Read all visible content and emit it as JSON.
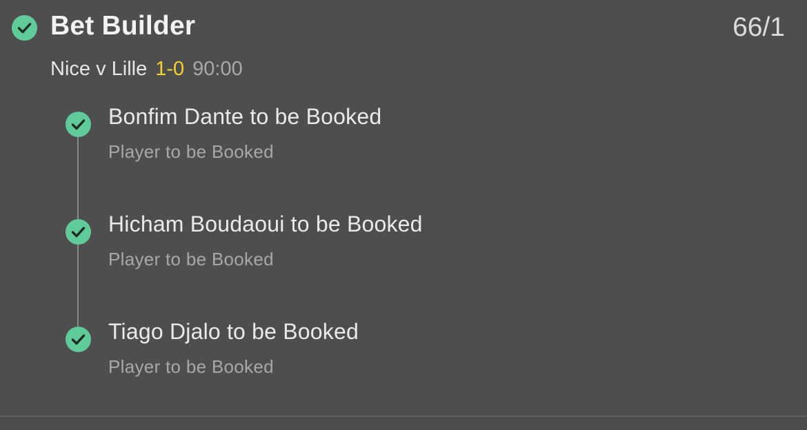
{
  "bet": {
    "title": "Bet Builder",
    "odds": "66/1",
    "status_icon": "check-circle-icon"
  },
  "match": {
    "name": "Nice v Lille",
    "score": "1-0",
    "clock": "90:00"
  },
  "legs": [
    {
      "title": "Bonfim Dante to be Booked",
      "market": "Player to be Booked",
      "icon": "check-circle-icon"
    },
    {
      "title": "Hicham Boudaoui to be Booked",
      "market": "Player to be Booked",
      "icon": "check-circle-icon"
    },
    {
      "title": "Tiago Djalo to be Booked",
      "market": "Player to be Booked",
      "icon": "check-circle-icon"
    }
  ],
  "colors": {
    "background": "#4e4e4e",
    "success_green": "#5fcb9a",
    "score_yellow": "#f5d130",
    "primary_text": "#f2f2f2",
    "secondary_text": "#a8a8a8"
  }
}
